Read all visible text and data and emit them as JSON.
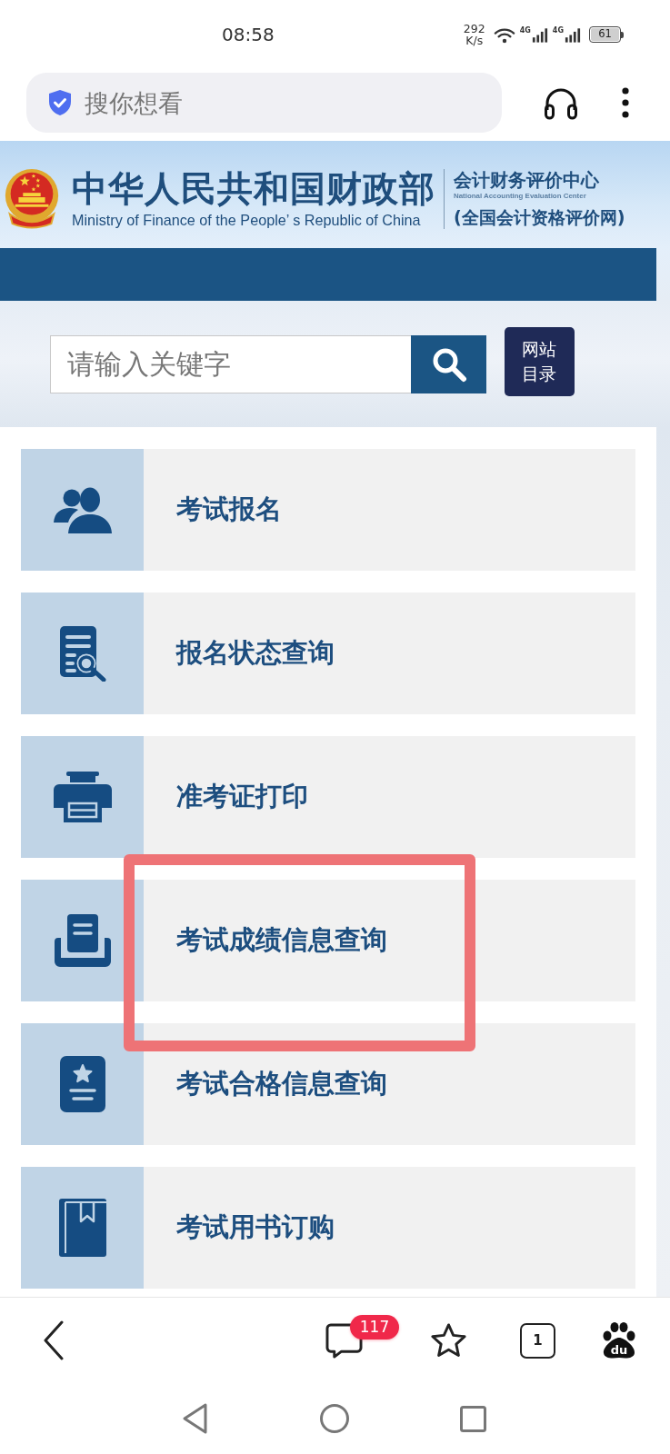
{
  "status_bar": {
    "time": "08:58",
    "speed": "292",
    "speed_unit": "K/s",
    "networks": [
      {
        "type": "4G"
      },
      {
        "type": "4G"
      }
    ],
    "battery": "61"
  },
  "browser_bar": {
    "placeholder": "搜你想看"
  },
  "site_header": {
    "title": "中华人民共和国财政部",
    "subtitle": "Ministry of Finance of the People’ s Republic of China",
    "center_name": "会计财务评价中心",
    "center_name_en": "National Accounting Evaluation Center",
    "site_name": "(全国会计资格评价网)"
  },
  "site_search": {
    "placeholder": "请输入关键字",
    "directory_button": "网站目录"
  },
  "menu": [
    {
      "label": "考试报名",
      "kind": "people",
      "highlighted": false
    },
    {
      "label": "报名状态查询",
      "kind": "document-search",
      "highlighted": false
    },
    {
      "label": "准考证打印",
      "kind": "printer",
      "highlighted": false
    },
    {
      "label": "考试成绩信息查询",
      "kind": "tray",
      "highlighted": true
    },
    {
      "label": "考试合格信息查询",
      "kind": "certificate",
      "highlighted": false
    },
    {
      "label": "考试用书订购",
      "kind": "book",
      "highlighted": false
    }
  ],
  "bottom_bar": {
    "message_count": "117",
    "tab_count": "1",
    "logo_text": "du"
  }
}
